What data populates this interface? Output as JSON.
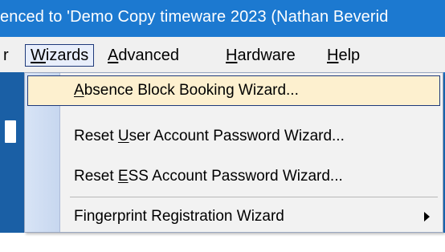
{
  "window": {
    "title": "enced to 'Demo Copy timeware 2023 (Nathan Beverid"
  },
  "menu_bar": {
    "items": [
      {
        "prefix": "",
        "mnemonic": "",
        "suffix": "r",
        "id": "partial"
      },
      {
        "prefix": "",
        "mnemonic": "W",
        "suffix": "izards",
        "id": "wizards"
      },
      {
        "prefix": "",
        "mnemonic": "A",
        "suffix": "dvanced",
        "id": "advanced"
      },
      {
        "prefix": "",
        "mnemonic": "H",
        "suffix": "ardware",
        "id": "hardware"
      },
      {
        "prefix": "",
        "mnemonic": "H",
        "suffix": "elp",
        "id": "help"
      }
    ],
    "active": "Wizards"
  },
  "wizards_menu": {
    "items": [
      {
        "prefix": "",
        "mnemonic": "A",
        "suffix": "bsence Block Booking Wizard...",
        "highlighted": true
      },
      {
        "prefix": "Reset ",
        "mnemonic": "U",
        "suffix": "ser Account Password Wizard...",
        "highlighted": false
      },
      {
        "prefix": "Reset ",
        "mnemonic": "E",
        "suffix": "SS Account Password Wizard...",
        "highlighted": false
      },
      {
        "prefix": "Fingerprint Registration Wizard",
        "mnemonic": "",
        "suffix": "",
        "highlighted": false,
        "has_submenu": true
      }
    ]
  },
  "colors": {
    "title_bar": "#1c79d0",
    "menu_bar": "#f0f0f0",
    "highlight_bg": "#fdf0cf",
    "highlight_border": "#1f3a7a"
  },
  "icons": {
    "submenu": "chevron-right-icon"
  }
}
